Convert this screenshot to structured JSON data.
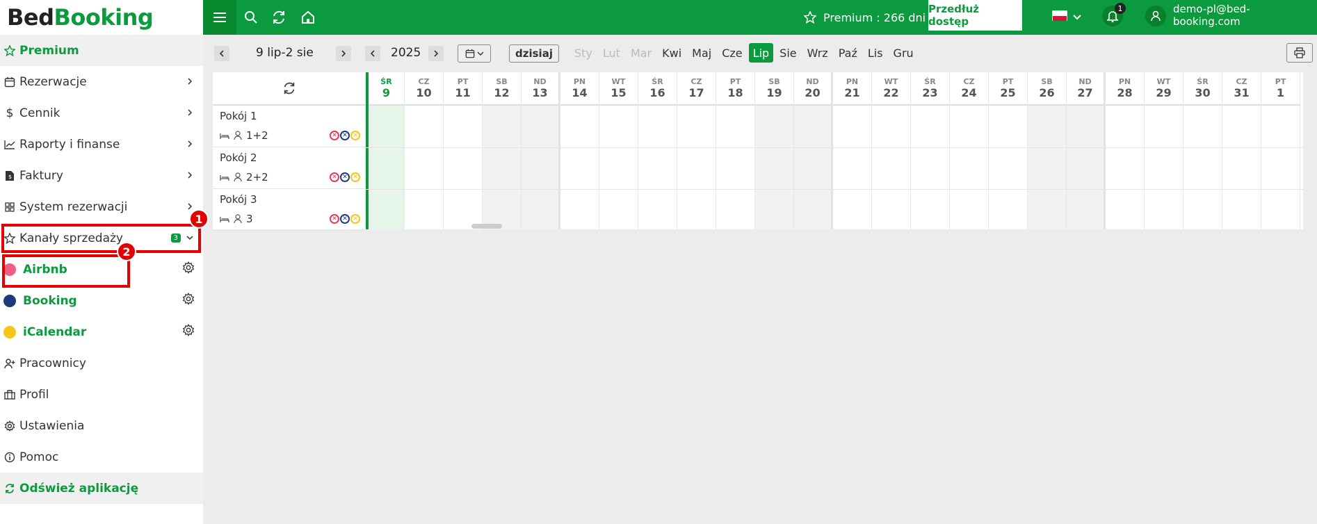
{
  "logo": {
    "bed": "Bed",
    "booking": "Booking"
  },
  "topbar": {
    "premium_label": "Premium : 266 dni",
    "extend_label": "Przedłuż dostęp",
    "notif_count": "1",
    "user_email": "demo-pl@bed-booking.com",
    "accent": "#0b9a3e"
  },
  "sidebar": {
    "premium": "Premium",
    "items": [
      {
        "label": "Rezerwacje"
      },
      {
        "label": "Cennik"
      },
      {
        "label": "Raporty i finanse"
      },
      {
        "label": "Faktury"
      },
      {
        "label": "System rezerwacji"
      },
      {
        "label": "Kanały sprzedaży",
        "badge": "3"
      }
    ],
    "channels": [
      {
        "label": "Airbnb",
        "color": "#f06080"
      },
      {
        "label": "Booking",
        "color": "#1f3a7a"
      },
      {
        "label": "iCalendar",
        "color": "#f5c518"
      }
    ],
    "bottom": [
      {
        "label": "Pracownicy"
      },
      {
        "label": "Profil"
      },
      {
        "label": "Ustawienia"
      },
      {
        "label": "Pomoc"
      }
    ],
    "refresh": "Odśwież aplikację"
  },
  "annotations": {
    "first": "1",
    "second": "2"
  },
  "toolbar": {
    "range": "9 lip-2 sie",
    "year": "2025",
    "today": "dzisiaj",
    "months": [
      "Sty",
      "Lut",
      "Mar",
      "Kwi",
      "Maj",
      "Cze",
      "Lip",
      "Sie",
      "Wrz",
      "Paź",
      "Lis",
      "Gru"
    ],
    "active_month": "Lip"
  },
  "calendar": {
    "days": [
      {
        "name": "ŚR",
        "num": "9"
      },
      {
        "name": "CZ",
        "num": "10"
      },
      {
        "name": "PT",
        "num": "11"
      },
      {
        "name": "SB",
        "num": "12"
      },
      {
        "name": "ND",
        "num": "13"
      },
      {
        "name": "PN",
        "num": "14"
      },
      {
        "name": "WT",
        "num": "15"
      },
      {
        "name": "ŚR",
        "num": "16"
      },
      {
        "name": "CZ",
        "num": "17"
      },
      {
        "name": "PT",
        "num": "18"
      },
      {
        "name": "SB",
        "num": "19"
      },
      {
        "name": "ND",
        "num": "20"
      },
      {
        "name": "PN",
        "num": "21"
      },
      {
        "name": "WT",
        "num": "22"
      },
      {
        "name": "ŚR",
        "num": "23"
      },
      {
        "name": "CZ",
        "num": "24"
      },
      {
        "name": "PT",
        "num": "25"
      },
      {
        "name": "SB",
        "num": "26"
      },
      {
        "name": "ND",
        "num": "27"
      },
      {
        "name": "PN",
        "num": "28"
      },
      {
        "name": "WT",
        "num": "29"
      },
      {
        "name": "ŚR",
        "num": "30"
      },
      {
        "name": "CZ",
        "num": "31"
      },
      {
        "name": "PT",
        "num": "1"
      }
    ],
    "rooms": [
      {
        "name": "Pokój 1",
        "capacity": "1+2"
      },
      {
        "name": "Pokój 2",
        "capacity": "2+2"
      },
      {
        "name": "Pokój 3",
        "capacity": "3"
      }
    ]
  }
}
